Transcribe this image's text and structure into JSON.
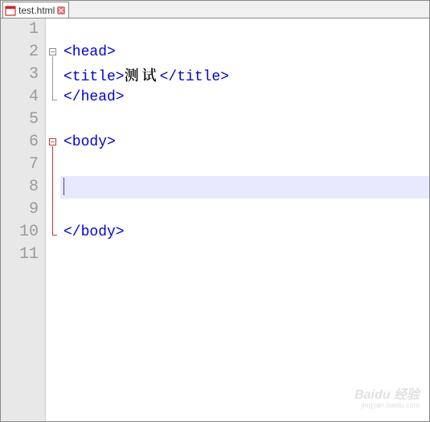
{
  "tab": {
    "filename": "test.html"
  },
  "lines": {
    "l1": "1",
    "l2": "2",
    "l3": "3",
    "l4": "4",
    "l5": "5",
    "l6": "6",
    "l7": "7",
    "l8": "8",
    "l9": "9",
    "l10": "10",
    "l11": "11"
  },
  "code": {
    "head_open": "<head>",
    "title_open": "<title>",
    "title_text": "测试",
    "title_close": "</title>",
    "head_close": "</head>",
    "body_open": "<body>",
    "body_close": "</body>"
  },
  "watermark": {
    "brand": "Baidu 经验",
    "url": "jingyan.baidu.com"
  }
}
